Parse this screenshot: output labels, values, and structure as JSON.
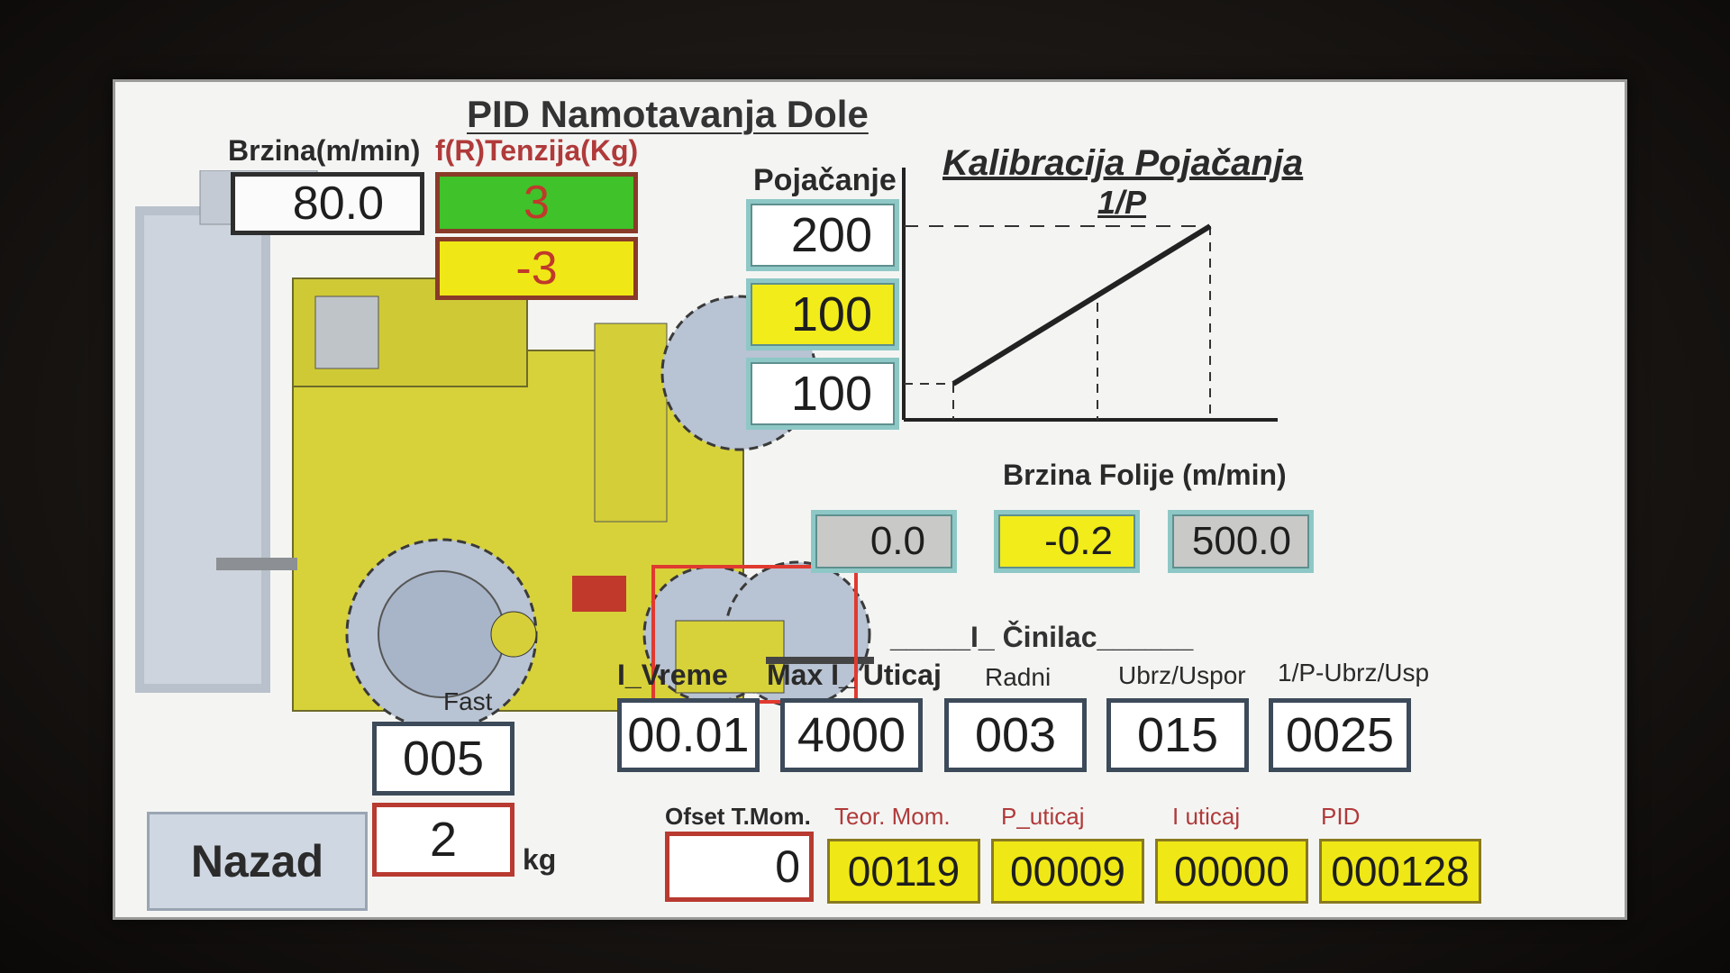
{
  "screen": {
    "title": "PID Namotavanja Dole",
    "speed_label": "Brzina(m/min)",
    "tension_label": "f(R)Tenzija(Kg)",
    "speed_value": "80.0",
    "tension_value": "3",
    "tension_error": "-3",
    "gain_label": "Pojačanje",
    "gain_values": [
      "200",
      "100",
      "100"
    ],
    "calib_title": "Kalibracija Pojačanja",
    "calib_subtitle": "1/P",
    "film_speed_label": "Brzina Folije (m/min)",
    "film_speed_values": [
      "0.0",
      "-0.2",
      "500.0"
    ],
    "cinilac_label": "_____I_ Činilac______",
    "fast_label": "Fast",
    "fast_value": "005",
    "kg_value": "2",
    "kg_unit": "kg",
    "nazad_label": "Nazad",
    "params": {
      "labels": [
        "I_Vreme",
        "Max I_ Uticaj",
        "Radni",
        "Ubrz/Uspor",
        "1/P-Ubrz/Usp"
      ],
      "values": [
        "00.01",
        "4000",
        "003",
        "015",
        "0025"
      ]
    },
    "bottom": {
      "offset_label": "Ofset T.Mom.",
      "offset_value": "0",
      "labels": [
        "Teor. Mom.",
        "P_uticaj",
        "I uticaj",
        "PID"
      ],
      "values": [
        "00119",
        "00009",
        "00000",
        "000128"
      ]
    },
    "colors": {
      "green": "#3fc22a",
      "yellow": "#efe816",
      "tension_text": "#c0392b",
      "label_red": "#b03a3a"
    }
  }
}
